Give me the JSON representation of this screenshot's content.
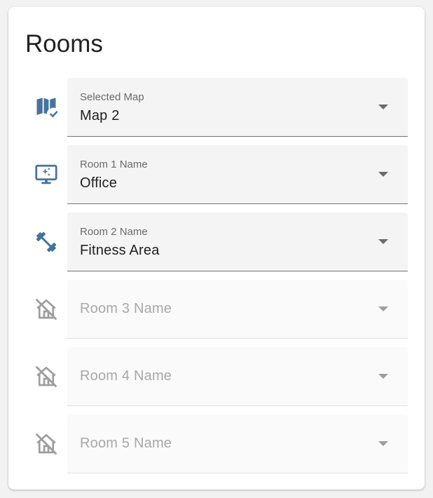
{
  "card": {
    "title": "Rooms"
  },
  "fields": [
    {
      "id": "selected-map",
      "label": "Selected Map",
      "value": "Map 2",
      "icon": "map-check-icon",
      "enabled": true
    },
    {
      "id": "room-1",
      "label": "Room 1 Name",
      "value": "Office",
      "icon": "monitor-sparkle-icon",
      "enabled": true
    },
    {
      "id": "room-2",
      "label": "Room 2 Name",
      "value": "Fitness Area",
      "icon": "dumbbell-icon",
      "enabled": true
    },
    {
      "id": "room-3",
      "label": "Room 3 Name",
      "value": "",
      "icon": "home-off-icon",
      "enabled": false
    },
    {
      "id": "room-4",
      "label": "Room 4 Name",
      "value": "",
      "icon": "home-off-icon",
      "enabled": false
    },
    {
      "id": "room-5",
      "label": "Room 5 Name",
      "value": "",
      "icon": "home-off-icon",
      "enabled": false
    }
  ],
  "colors": {
    "icon_active": "#44739e",
    "icon_disabled": "#9e9e9e",
    "field_bg": "#f4f4f4",
    "field_bg_disabled": "#fafafa"
  }
}
